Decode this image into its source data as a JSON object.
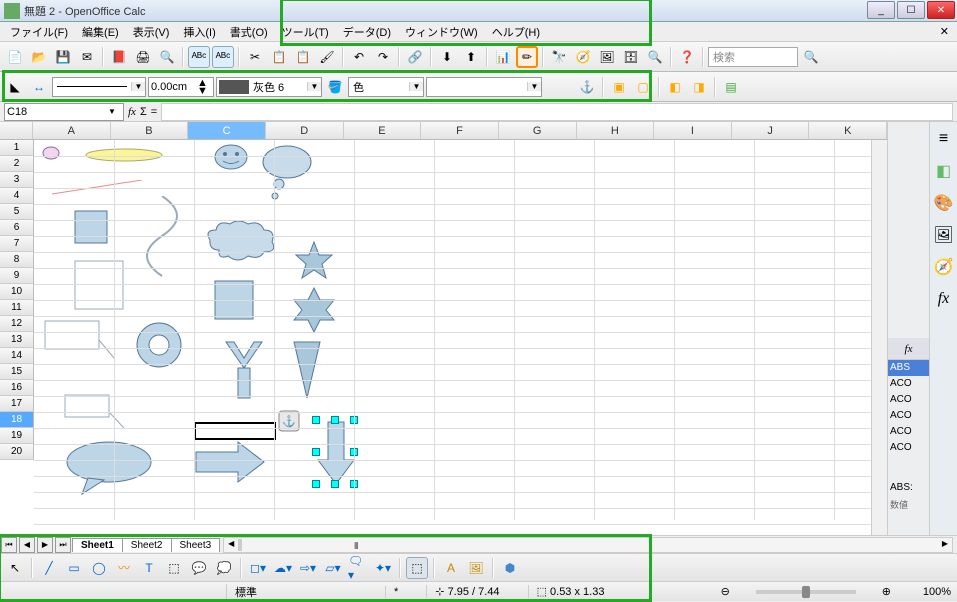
{
  "window": {
    "title": "無題 2 - OpenOffice Calc"
  },
  "winbtns": {
    "min": "_",
    "max": "☐",
    "close": "✕"
  },
  "menu": [
    "ファイル(F)",
    "編集(E)",
    "表示(V)",
    "挿入(I)",
    "書式(O)",
    "ツール(T)",
    "データ(D)",
    "ウィンドウ(W)",
    "ヘルプ(H)"
  ],
  "toolbar1": {
    "search_placeholder": "検索"
  },
  "toolbar2": {
    "linewidth": "0.00cm",
    "colorname": "灰色 6",
    "fillmode": "色"
  },
  "namebox": "C18",
  "columns": [
    "A",
    "B",
    "C",
    "D",
    "E",
    "F",
    "G",
    "H",
    "I",
    "J",
    "K"
  ],
  "sel_col": "C",
  "rows": 20,
  "sel_row": 18,
  "tabs": [
    "Sheet1",
    "Sheet2",
    "Sheet3"
  ],
  "active_tab": 0,
  "fnlist": [
    "ABS",
    "ACO",
    "ACO",
    "ACO",
    "ACO",
    "ACO"
  ],
  "fnextra": "ABS:",
  "status": {
    "mode": "標準",
    "star": "*",
    "pos": "7.95 / 7.44",
    "size": "0.53 x 1.33",
    "zoom": "100%"
  },
  "chart_data": null
}
